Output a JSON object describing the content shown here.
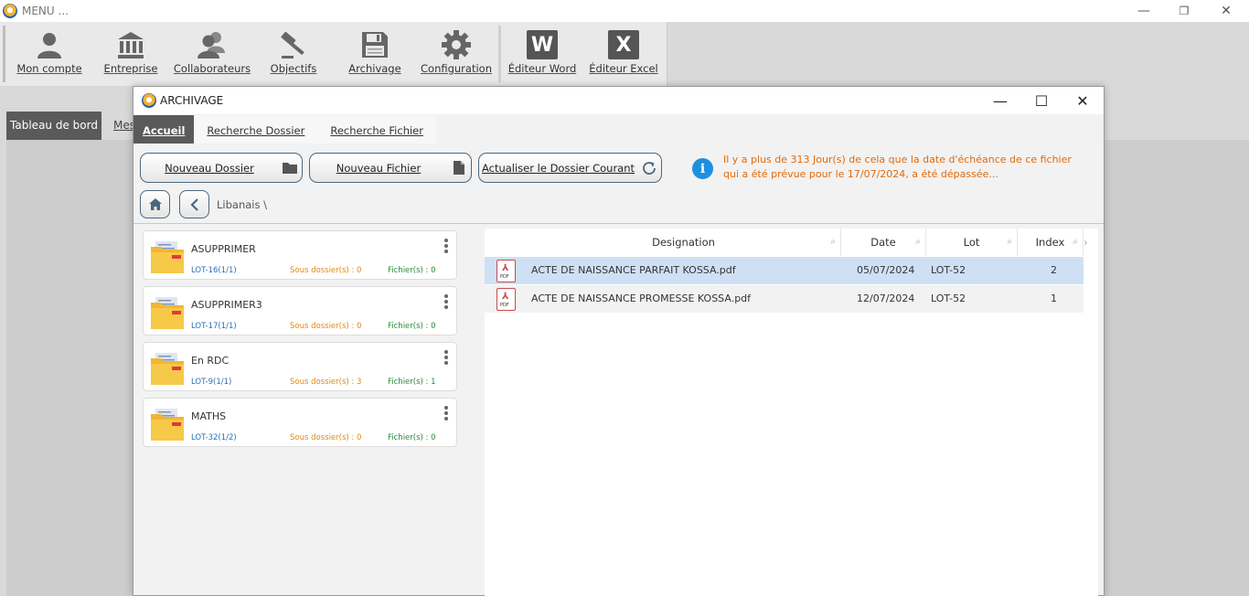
{
  "app": {
    "title": "MENU ..."
  },
  "window_controls": {
    "minimize": "—",
    "restore": "❐",
    "close": "✕"
  },
  "ribbon": {
    "items": [
      {
        "label": "Mon compte",
        "icon": "user-icon"
      },
      {
        "label": "Entreprise",
        "icon": "bank-icon"
      },
      {
        "label": "Collaborateurs",
        "icon": "users-icon"
      },
      {
        "label": "Objectifs",
        "icon": "gavel-icon"
      },
      {
        "label": "Archivage",
        "icon": "save-icon"
      },
      {
        "label": "Configuration",
        "icon": "gear-icon"
      },
      {
        "label": "Éditeur Word",
        "icon": "word-icon",
        "glyph": "W"
      },
      {
        "label": "Éditeur Excel",
        "icon": "excel-icon",
        "glyph": "X"
      }
    ]
  },
  "background_tabs": [
    {
      "label": "Tableau de bord"
    },
    {
      "label": "Mes"
    }
  ],
  "dialog": {
    "title": "ARCHIVAGE",
    "controls": {
      "minimize": "—",
      "maximize": "☐",
      "close": "✕"
    },
    "tabs": [
      {
        "label": "Accueil"
      },
      {
        "label": "Recherche Dossier"
      },
      {
        "label": "Recherche Fichier"
      }
    ],
    "toolbar": {
      "new_folder": "Nouveau Dossier",
      "new_file": "Nouveau Fichier",
      "refresh": "Actualiser le Dossier Courant"
    },
    "info_icon": "i",
    "info_message": "Il y a plus de 313 Jour(s) de cela que la date d'échéance de ce fichier qui a été prévue pour le 17/07/2024, a été dépassée...",
    "breadcrumb": "Libanais \\",
    "folders": [
      {
        "name": "ASUPPRIMER",
        "lot": "LOT-16(1/1)",
        "sous": "Sous dossier(s) : 0",
        "fichiers": "Fichier(s) : 0"
      },
      {
        "name": "ASUPPRIMER3",
        "lot": "LOT-17(1/1)",
        "sous": "Sous dossier(s) : 0",
        "fichiers": "Fichier(s) : 0"
      },
      {
        "name": "En RDC",
        "lot": "LOT-9(1/1)",
        "sous": "Sous dossier(s) : 3",
        "fichiers": "Fichier(s) : 1"
      },
      {
        "name": "MATHS",
        "lot": "LOT-32(1/2)",
        "sous": "Sous dossier(s) : 0",
        "fichiers": "Fichier(s) : 0"
      }
    ],
    "grid": {
      "columns": {
        "designation": "Designation",
        "date": "Date",
        "lot": "Lot",
        "index": "Index"
      },
      "rows": [
        {
          "designation": "ACTE DE NAISSANCE PARFAIT KOSSA.pdf",
          "date": "05/07/2024",
          "lot": "LOT-52",
          "index": "2",
          "selected": true
        },
        {
          "designation": "ACTE DE NAISSANCE PROMESSE KOSSA.pdf",
          "date": "12/07/2024",
          "lot": "LOT-52",
          "index": "1",
          "selected": false
        }
      ],
      "file_icon_label": "PDF"
    }
  }
}
